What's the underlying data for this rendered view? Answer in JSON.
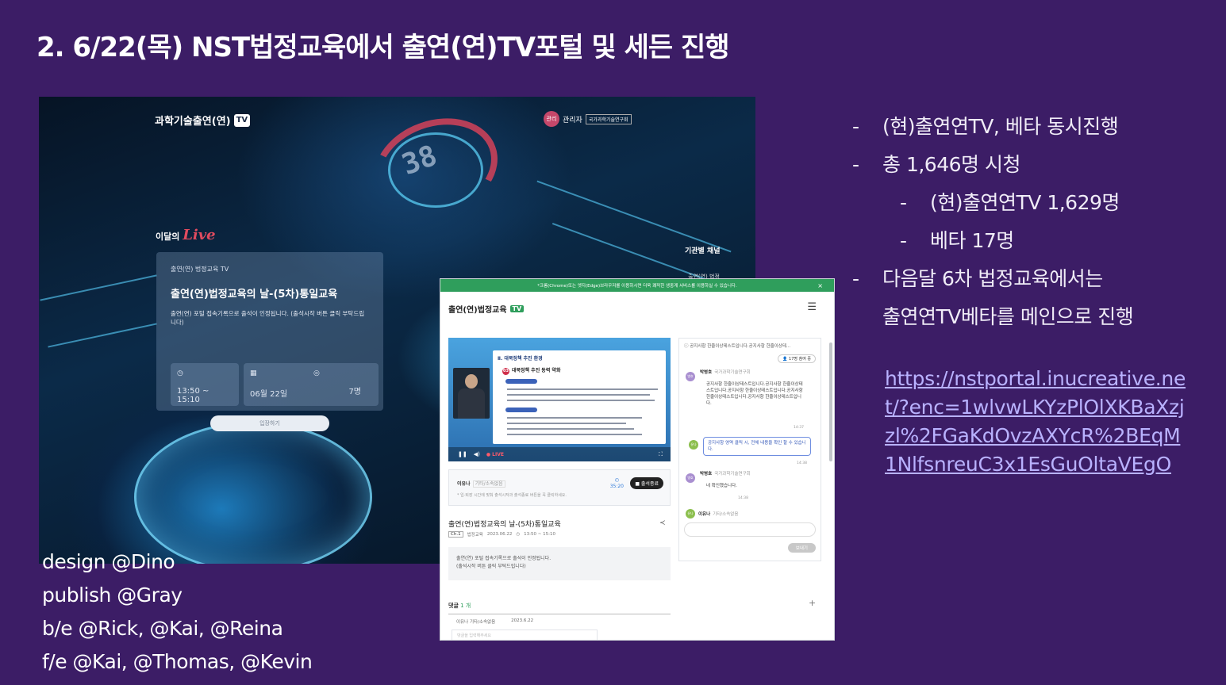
{
  "slide": {
    "title": "2. 6/22(목) NST법정교육에서 출연(연)TV포털 및 세든 진행"
  },
  "screenshot_live": {
    "logo": "과학기술출연(연)",
    "logo_badge": "TV",
    "admin_avatar": "관리",
    "admin_name": "관리자",
    "admin_org": "국가과학기술연구회",
    "live_prefix": "이달의",
    "live_word": "Live",
    "channel_title": "기관별 채널",
    "channel_sub": "출연(연) 법정",
    "card": {
      "crumb": "출연(연) 법정교육 TV",
      "title": "출연(연)법정교육의 날-(5차)통일교육",
      "desc": "출연(연) 포털 접속기록으로 출석이 인정됩니다. (출석시작 버튼 클릭 부탁드립니다)",
      "time": "13:50 ~ 15:10",
      "date": "06월 22일",
      "viewers": "7명",
      "join": "입장하기"
    },
    "hud_number": "38"
  },
  "credits": [
    "design @Dino",
    "publish @Gray",
    "b/e @Rick, @Kai, @Reina",
    "f/e @Kai, @Thomas, @Kevin"
  ],
  "screenshot_portal": {
    "notice": "*크롬(Chrome)또는 엣지(Edge)브라우저를 이용하시면 더욱 쾌적한 생중계 서비스를 이용하실 수 있습니다.",
    "notice_close": "×",
    "brand": "출연(연)법정교육",
    "brand_badge": "TV",
    "slide_heading": "Ⅱ. 대북정책 추진 환경",
    "slide_sub": "대북정책 추진 동력 약화",
    "slide_num": "03",
    "player_live": "● LIVE",
    "attend_name": "이유나",
    "attend_org": "기타/소속없음",
    "attend_hint": "* 입·퇴장 시간에 맞춰 출석시작과 출석종료 버튼을 꼭 클릭하세요.",
    "attend_timer": "35:20",
    "attend_end": "■ 출석종료",
    "video_title": "출연(연)법정교육의 날-(5차)통일교육",
    "meta_channel": "Ch.1",
    "meta_tag": "법정교육",
    "meta_date": "2023.06.22",
    "meta_time": "13:50 ~ 15:10",
    "info_line1": "출연(연) 포털 접속기록으로 출석이 인정됩니다.",
    "info_line2": "(출석시작 버튼 클릭 부탁드립니다)",
    "comments_label": "댓글",
    "comments_count": "1 개",
    "comment_name": "이유나",
    "comment_org": "기타/소속없음",
    "comment_date": "2023.6.22",
    "comment_placeholder": "댓글을 입력해주세요",
    "chat": {
      "notice": "공지사항 한줄이상테스트입니다.공지사항 한줄이상테...",
      "viewers": "17명 참여 중",
      "msg1_name": "박병호",
      "msg1_org": "국가과학기술연구회",
      "msg1_text": "공지사항 한줄이상테스트입니다.공지사항 한줄이상테스트입니다.공지사항 한줄이상테스트입니다.공지사항 한줄이상테스트입니다.공지사항 한줄이상테스트입니다.",
      "msg1_time": "14:37",
      "msg2_text": "공지사항 영역 클릭 시, 전체 내용을 확인 할 수 있습니다.",
      "msg2_time": "14:38",
      "msg3_name": "박병호",
      "msg3_org": "국가과학기술연구회",
      "msg3_text": "네 확인했습니다.",
      "msg3_time": "14:38",
      "me_name": "이유나",
      "me_org": "기타/소속없음",
      "send": "보내기"
    }
  },
  "bullets": [
    {
      "level": 1,
      "text": "(현)출연연TV, 베타 동시진행"
    },
    {
      "level": 1,
      "text": "총 1,646명 시청"
    },
    {
      "level": 2,
      "text": "(현)출연연TV 1,629명"
    },
    {
      "level": 2,
      "text": "베타 17명"
    },
    {
      "level": 1,
      "text": "다음달 6차 법정교육에서는"
    },
    {
      "level": 1,
      "text": "출연연TV베타를 메인으로 진행",
      "nodash": true
    }
  ],
  "url": "https://nstportal.inucreative.net/?enc=1wlvwLKYzPlOlXKBaXzjzl%2FGaKdOvzAXYcR%2BEqM1NlfsnreuC3x1EsGuOltaVEgO",
  "colors": {
    "background": "#3c1d66",
    "link": "#b9b2ff",
    "portal_green": "#2f9e5c",
    "live_red": "#e04b5f"
  }
}
